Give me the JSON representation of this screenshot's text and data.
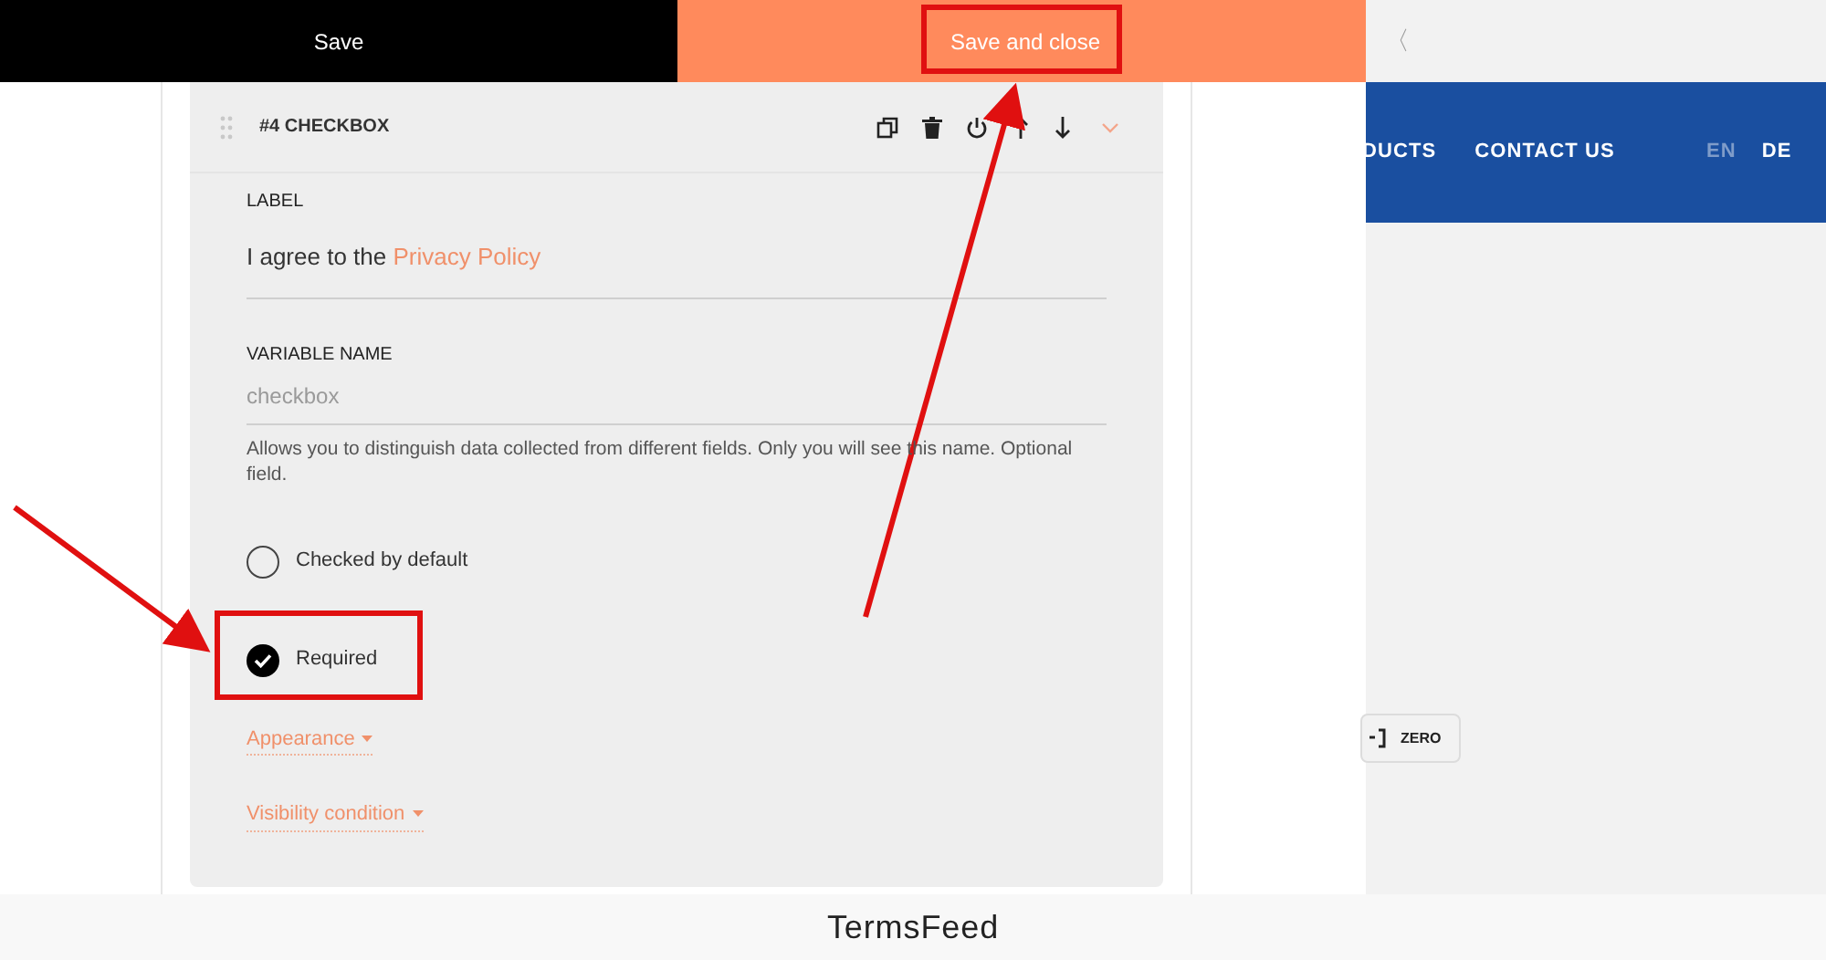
{
  "top_bar": {
    "buttons": [
      {
        "label": "Save",
        "kind": "dark"
      },
      {
        "label": "Save and close",
        "kind": "accent"
      }
    ]
  },
  "field": {
    "title": "#4 CHECKBOX",
    "expanded": true,
    "label": {
      "caption": "LABEL",
      "text": "I agree to the ",
      "link": "Privacy Policy"
    },
    "variable_name": {
      "caption": "VARIABLE NAME",
      "placeholder": "checkbox",
      "help": "Allows you to distinguish data collected from different fields. Only you will see this name. Optional field."
    },
    "options": [
      {
        "label": "Checked by default",
        "checked": false
      },
      {
        "label": "Required",
        "checked": true
      }
    ],
    "sections": [
      "Appearance",
      "Visibility condition"
    ]
  },
  "site_preview": {
    "back": "〈",
    "nav": [
      {
        "label": "DUCTS",
        "kind": "link"
      },
      {
        "label": "CONTACT US",
        "kind": "link"
      },
      {
        "label": "EN",
        "kind": "lang",
        "selected": false
      },
      {
        "label": "DE",
        "kind": "lang",
        "selected": true
      }
    ],
    "zero_button": "ZERO"
  },
  "footer": "TermsFeed"
}
